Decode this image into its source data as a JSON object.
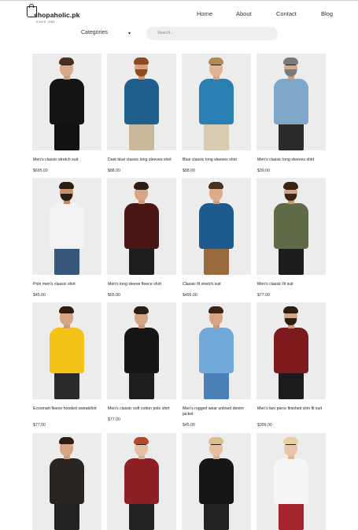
{
  "header": {
    "logo_text": "shopaholic.pk",
    "logo_tagline": "SINCE 1985",
    "nav": [
      "Home",
      "About",
      "Contact",
      "Blog"
    ]
  },
  "controls": {
    "categories_label": "Categories",
    "search_placeholder": "Search..."
  },
  "products": [
    {
      "title": "Men's classic stretch suit",
      "price": "$695.00"
    },
    {
      "title": "Dark blue classic long sleeves shirt",
      "price": "$88.00"
    },
    {
      "title": "Blue classic long sleeves shirt",
      "price": "$88.00"
    },
    {
      "title": "Men's classic long sleeves shirt",
      "price": "$39.00"
    },
    {
      "title": "Polo men's classic shirt",
      "price": "$45.00"
    },
    {
      "title": "Men's long sleeve fleece shirt",
      "price": "$65.00"
    },
    {
      "title": "Classic fit stretch suit",
      "price": "$495.00"
    },
    {
      "title": "Men's classic fit suit",
      "price": "$77.00"
    },
    {
      "title": "Ecosmart fleece hooded sweatshirt",
      "price": "$77.00"
    },
    {
      "title": "Men's classic soft cotton polo shirt",
      "price": "$77.00"
    },
    {
      "title": "Men's rugged wear unlined denim jacket",
      "price": "$45.00"
    },
    {
      "title": "Men's two piece finished slim fit suit",
      "price": "$399.00"
    },
    {
      "title": "",
      "price": ""
    },
    {
      "title": "",
      "price": ""
    },
    {
      "title": "",
      "price": ""
    },
    {
      "title": "",
      "price": ""
    }
  ]
}
